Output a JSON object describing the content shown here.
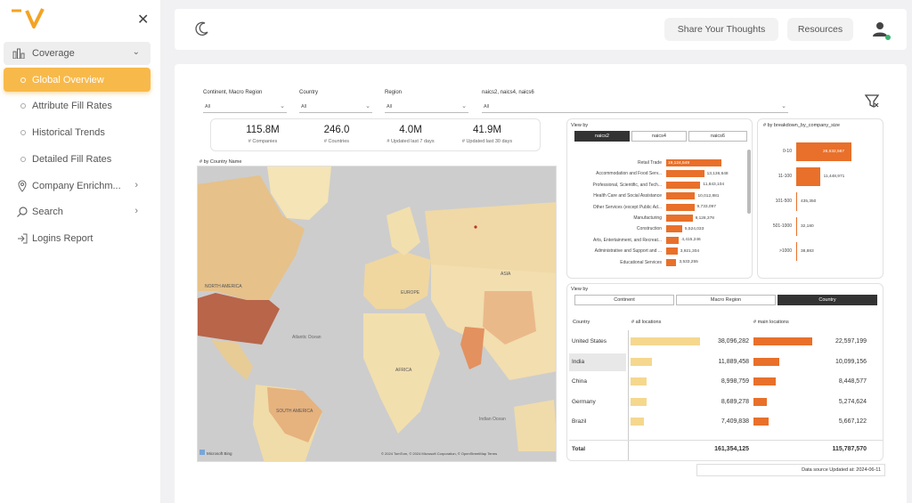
{
  "sidebar": {
    "coverage_label": "Coverage",
    "items": [
      {
        "label": "Global Overview"
      },
      {
        "label": "Attribute Fill Rates"
      },
      {
        "label": "Historical Trends"
      },
      {
        "label": "Detailed Fill Rates"
      },
      {
        "label": "Company Enrichm..."
      },
      {
        "label": "Search"
      },
      {
        "label": "Logins Report"
      }
    ]
  },
  "header": {
    "share_label": "Share Your Thoughts",
    "resources_label": "Resources"
  },
  "filters": [
    {
      "label": "Continent, Macro Region",
      "value": "All"
    },
    {
      "label": "Country",
      "value": "All"
    },
    {
      "label": "Region",
      "value": "All"
    },
    {
      "label": "naics2, naics4, naics6",
      "value": "All"
    }
  ],
  "kpis": [
    {
      "value": "115.8M",
      "label": "# Companies"
    },
    {
      "value": "246.0",
      "label": "# Countries"
    },
    {
      "value": "4.0M",
      "label": "# Updated last 7 days"
    },
    {
      "value": "41.9M",
      "label": "# Updated last 30 days"
    }
  ],
  "map": {
    "title": "# by Country Name",
    "labels": {
      "north_america": "NORTH AMERICA",
      "south_america": "SOUTH AMERICA",
      "europe": "EUROPE",
      "asia": "ASIA",
      "africa": "AFRICA",
      "atlantic": "Atlantic Ocean",
      "indian": "Indian Ocean"
    },
    "attribution": "© 2024 TomTom, © 2024 Microsoft Corporation, © OpenStreetMap  Terms",
    "bing": "Microsoft Bing"
  },
  "industry_panel": {
    "view_by": "View by",
    "tabs": [
      "naics2",
      "naics4",
      "naics6"
    ],
    "active_tab": 0
  },
  "size_panel": {
    "title": "# by breakdown_by_company_size"
  },
  "country_panel": {
    "view_by": "View by",
    "tabs": [
      "Continent",
      "Macro Region",
      "Country"
    ],
    "active_tab": 2,
    "col_country": "Country",
    "col_all": "# all locations",
    "col_main": "# main locations",
    "total_label": "Total",
    "total_all": "161,354,125",
    "total_main": "115,787,570"
  },
  "footer": {
    "data_source": "Data source Updated at: 2024-06-11"
  },
  "chart_data": [
    {
      "type": "bar",
      "orientation": "horizontal",
      "categories": [
        "Retail Trade",
        "Accommodation and Food Serv...",
        "Professional, Scientific, and Tech...",
        "Health Care and Social Assistance",
        "Other Services (except Public Ad...",
        "Manufacturing",
        "Construction",
        "Arts, Entertainment, and Recreat...",
        "Administrative and Support and ...",
        "Educational Services"
      ],
      "values": [
        19124549,
        13136648,
        11843104,
        10012881,
        9733097,
        9128378,
        5524033,
        4415246,
        3921304,
        3533255
      ],
      "labels": [
        "19,124,549",
        "13,136,648",
        "11,843,104",
        "10,012,881",
        "9,733,097",
        "9,128,378",
        "5,524,033",
        "4,415,246",
        "3,921,304",
        "3,533,255"
      ]
    },
    {
      "type": "bar",
      "orientation": "horizontal",
      "title": "# by breakdown_by_company_size",
      "categories": [
        "0-10",
        "11-100",
        "101-500",
        "501-1000",
        ">1000"
      ],
      "values": [
        26632567,
        11448971,
        435350,
        32180,
        38883
      ],
      "labels": [
        "26,632,567",
        "11,448,971",
        "435,350",
        "32,180",
        "38,883"
      ]
    },
    {
      "type": "table",
      "columns": [
        "Country",
        "# all locations",
        "# main locations"
      ],
      "rows": [
        {
          "country": "United States",
          "all": 38096282,
          "all_label": "38,096,282",
          "main": 22597199,
          "main_label": "22,597,199"
        },
        {
          "country": "India",
          "all": 11889458,
          "all_label": "11,889,458",
          "main": 10099156,
          "main_label": "10,099,156"
        },
        {
          "country": "China",
          "all": 8998759,
          "all_label": "8,998,759",
          "main": 8448577,
          "main_label": "8,448,577"
        },
        {
          "country": "Germany",
          "all": 8689278,
          "all_label": "8,689,278",
          "main": 5274624,
          "main_label": "5,274,624"
        },
        {
          "country": "Brazil",
          "all": 7409838,
          "all_label": "7,409,838",
          "main": 5667122,
          "main_label": "5,667,122"
        }
      ]
    }
  ],
  "colors": {
    "accent": "#f8b94b",
    "bar": "#e8702a",
    "bar_light": "#f5d88e"
  }
}
